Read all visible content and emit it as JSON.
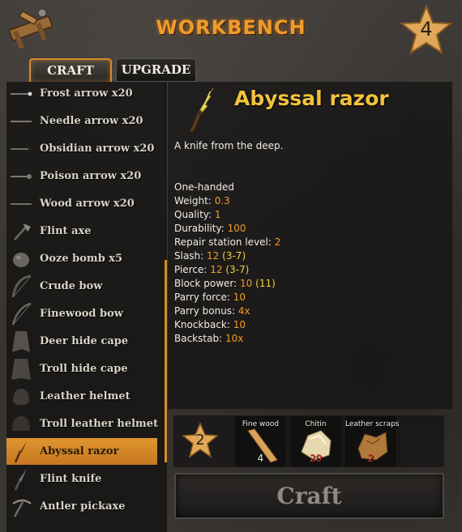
{
  "header": {
    "title": "WORKBENCH",
    "station_level": "4"
  },
  "tabs": {
    "craft": "CRAFT",
    "upgrade": "UPGRADE"
  },
  "recipes": [
    {
      "label": "Frost arrow x20",
      "icon": "frost-arrow-icon"
    },
    {
      "label": "Needle arrow x20",
      "icon": "needle-arrow-icon"
    },
    {
      "label": "Obsidian arrow x20",
      "icon": "obsidian-arrow-icon"
    },
    {
      "label": "Poison arrow x20",
      "icon": "poison-arrow-icon"
    },
    {
      "label": "Wood arrow x20",
      "icon": "wood-arrow-icon"
    },
    {
      "label": "Flint axe",
      "icon": "flint-axe-icon"
    },
    {
      "label": "Ooze bomb x5",
      "icon": "ooze-bomb-icon"
    },
    {
      "label": "Crude bow",
      "icon": "crude-bow-icon"
    },
    {
      "label": "Finewood bow",
      "icon": "finewood-bow-icon"
    },
    {
      "label": "Deer hide cape",
      "icon": "deer-hide-cape-icon"
    },
    {
      "label": "Troll hide cape",
      "icon": "troll-hide-cape-icon"
    },
    {
      "label": "Leather helmet",
      "icon": "leather-helmet-icon"
    },
    {
      "label": "Troll leather helmet",
      "icon": "troll-leather-helmet-icon"
    },
    {
      "label": "Abyssal razor",
      "icon": "abyssal-razor-icon",
      "selected": true
    },
    {
      "label": "Flint knife",
      "icon": "flint-knife-icon"
    },
    {
      "label": "Antler pickaxe",
      "icon": "antler-pickaxe-icon"
    }
  ],
  "item": {
    "name": "Abyssal razor",
    "description": "A knife from the deep.",
    "icon": "abyssal-razor-icon",
    "stats": {
      "handedness": "One-handed",
      "weight_label": "Weight:",
      "weight": "0.3",
      "quality_label": "Quality:",
      "quality": "1",
      "durability_label": "Durability:",
      "durability": "100",
      "repair_label": "Repair station level:",
      "repair": "2",
      "slash_label": "Slash:",
      "slash": "12",
      "slash_range": "(3-7)",
      "pierce_label": "Pierce:",
      "pierce": "12",
      "pierce_range": "(3-7)",
      "block_label": "Block power:",
      "block": "10",
      "block_next": "(11)",
      "parry_force_label": "Parry force:",
      "parry_force": "10",
      "parry_bonus_label": "Parry bonus:",
      "parry_bonus": "4x",
      "knockback_label": "Knockback:",
      "knockback": "10",
      "backstab_label": "Backstab:",
      "backstab": "10x"
    }
  },
  "requirements": {
    "station_level": "2",
    "materials": [
      {
        "name": "Fine wood",
        "count": "4",
        "sufficient": true,
        "icon": "fine-wood-icon"
      },
      {
        "name": "Chitin",
        "count": "20",
        "sufficient": false,
        "icon": "chitin-icon"
      },
      {
        "name": "Leather scraps",
        "count": "2",
        "sufficient": false,
        "icon": "leather-scraps-icon"
      }
    ]
  },
  "craft_button": "Craft",
  "colors": {
    "accent_orange": "#d98a28",
    "title_orange": "#ef9a2a",
    "item_name_gold": "#f2c23a",
    "value_orange": "#f29b2a",
    "value_yellow": "#f2d23a",
    "missing_red": "#e0302a"
  }
}
